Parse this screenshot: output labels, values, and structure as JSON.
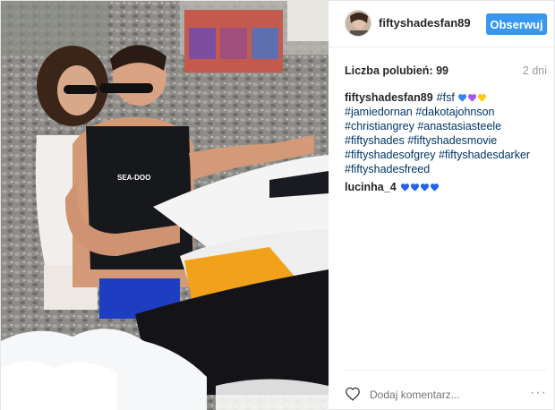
{
  "post": {
    "username": "fiftyshadesfan89",
    "follow_label": "Obserwuj",
    "likes_label": "Liczba polubień: 99",
    "time_ago": "2 dni",
    "add_comment_placeholder": "Dodaj komentarz...",
    "more_label": "···"
  },
  "caption": {
    "user": "fiftyshadesfan89",
    "parts": [
      {
        "text": "#fsf",
        "tag": true
      },
      {
        "text": " ",
        "tag": false
      },
      {
        "text": "#jamiedornan",
        "tag": true
      },
      {
        "text": " ",
        "tag": false
      },
      {
        "text": "#dakotajohnson",
        "tag": true
      },
      {
        "text": " ",
        "tag": false
      },
      {
        "text": "#christiangrey",
        "tag": true
      },
      {
        "text": " ",
        "tag": false
      },
      {
        "text": "#anastasiasteele",
        "tag": true
      },
      {
        "text": " ",
        "tag": false
      },
      {
        "text": "#fiftyshades",
        "tag": true
      },
      {
        "text": " ",
        "tag": false
      },
      {
        "text": "#fiftyshadesmovie",
        "tag": true
      },
      {
        "text": " ",
        "tag": false
      },
      {
        "text": "#fiftyshadesofgrey",
        "tag": true
      },
      {
        "text": " ",
        "tag": false
      },
      {
        "text": "#fiftyshadesdarker",
        "tag": true
      },
      {
        "text": " ",
        "tag": false
      },
      {
        "text": "#fiftyshadesfreed",
        "tag": true
      }
    ],
    "emoji_colors": [
      "#3b82f6",
      "#a855f7",
      "#facc15"
    ]
  },
  "comments": [
    {
      "user": "lucinha_4",
      "emoji_colors": [
        "#2563eb",
        "#2563eb",
        "#2563eb",
        "#2563eb"
      ]
    }
  ],
  "icons": {
    "heart": "heart-icon",
    "more": "more-options-icon"
  },
  "colors": {
    "accent": "#3897f0",
    "hashtag": "#003569",
    "muted": "#999999"
  }
}
